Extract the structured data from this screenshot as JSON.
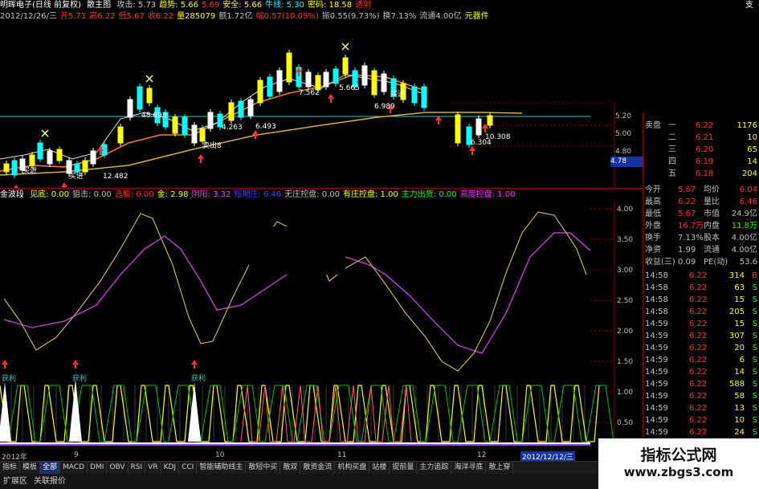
{
  "header": {
    "title": "明晖电子(日线 前复权)",
    "formula": "散主图",
    "items": [
      {
        "text": "攻击: 5.73",
        "color": "#d0d0d0"
      },
      {
        "text": "趋势: 5.66",
        "color": "#ffff00"
      },
      {
        "text": "5.69",
        "color": "#ff3030"
      },
      {
        "text": "安全: 5.66",
        "color": "#ffff00"
      },
      {
        "text": "牛线: 5.30",
        "color": "#00ffff"
      },
      {
        "text": "密码: 18.58",
        "color": "#ffff00"
      },
      {
        "text": "透射",
        "color": "#ff3030"
      }
    ],
    "right_char": "支"
  },
  "quote_line": {
    "items": [
      {
        "text": "2012/12/26/三",
        "color": "#c0c0c0"
      },
      {
        "text": "开5.71",
        "color": "#ff3030"
      },
      {
        "text": "高6.22",
        "color": "#ff3030"
      },
      {
        "text": "低5.67",
        "color": "#ff3030"
      },
      {
        "text": "收6.22",
        "color": "#ff3030"
      },
      {
        "text": "量285079",
        "color": "#ffff00"
      },
      {
        "text": "额1.72亿",
        "color": "#c0c0c0"
      },
      {
        "text": "幅0.57(10.09%)",
        "color": "#ff3030"
      },
      {
        "text": "振0.55(9.73%)",
        "color": "#c0c0c0"
      },
      {
        "text": "换7.13%",
        "color": "#c0c0c0"
      },
      {
        "text": "流通4.00亿",
        "color": "#c0c0c0"
      },
      {
        "text": "元器件",
        "color": "#ffff00"
      }
    ]
  },
  "main_chart": {
    "price_labels": [
      {
        "text": "48.693",
        "color": "#ffffff"
      },
      {
        "text": "4.263",
        "color": "#ffffff"
      },
      {
        "text": "6.493",
        "color": "#ffffff"
      },
      {
        "text": "7.562",
        "color": "#ffffff"
      },
      {
        "text": "5.665",
        "color": "#ffffff"
      },
      {
        "text": "6.989",
        "color": "#ffffff"
      },
      {
        "text": "12.482",
        "color": "#ffffff"
      },
      {
        "text": "10.308",
        "color": "#ffffff"
      },
      {
        "text": "6.304",
        "color": "#ffffff"
      }
    ],
    "signal_labels": [
      "买进",
      "卖出8",
      "买进",
      "买进"
    ],
    "axis_ticks": [
      "5.20",
      "5.00",
      "4.80"
    ],
    "price_box": "4.78"
  },
  "indicator": {
    "name": "金波段",
    "items": [
      {
        "text": "见底: 0.00",
        "color": "#ffff00"
      },
      {
        "text": "狙击: 0.00",
        "color": "#c0c0c0"
      },
      {
        "text": "选股: 0.00",
        "color": "#ff3030"
      },
      {
        "text": "金: 2.98",
        "color": "#ffff00"
      },
      {
        "text": "阴阳: 3.32",
        "color": "#ff30ff"
      },
      {
        "text": "短期庄: 6.46",
        "color": "#4040ff"
      },
      {
        "text": "无庄控盘: 0.00",
        "color": "#c0c0c0"
      },
      {
        "text": "有庄控盘: 1.00",
        "color": "#ffff00"
      },
      {
        "text": "主力出货: 0.00",
        "color": "#00ff00"
      },
      {
        "text": "高度控盘: 1.00",
        "color": "#ff30ff"
      }
    ],
    "axis_ticks": [
      "4.00",
      "3.50",
      "3.00",
      "2.50",
      "2.00",
      "1.50",
      "1.00",
      "0.50"
    ],
    "profit_labels": [
      "获利",
      "获利",
      "获利"
    ]
  },
  "date_axis": {
    "labels": [
      "2012年",
      "9",
      "10",
      "11",
      "12"
    ],
    "highlight": "2012/12/12/三"
  },
  "right_panel": {
    "ask_label": "卖盘",
    "ask_rows": [
      {
        "label": "一",
        "price": "6.22",
        "vol": "1176"
      },
      {
        "label": "二",
        "price": "6.21",
        "vol": "10"
      },
      {
        "label": "三",
        "price": "6.20",
        "vol": "65"
      },
      {
        "label": "四",
        "price": "6.19",
        "vol": "14"
      },
      {
        "label": "五",
        "price": "6.18",
        "vol": "204"
      }
    ],
    "stats": [
      {
        "l1": "今开",
        "v1": "5.67",
        "c1": "#ff3030",
        "l2": "均价",
        "v2": "6.04",
        "c2": "#ff3030"
      },
      {
        "l1": "最高",
        "v1": "6.22",
        "c1": "#ff3030",
        "l2": "量比",
        "v2": "6.46",
        "c2": "#ff3030"
      },
      {
        "l1": "最低",
        "v1": "5.67",
        "c1": "#ff3030",
        "l2": "市值",
        "v2": "24.9亿",
        "c2": "#c0c0c0"
      },
      {
        "l1": "外盘",
        "v1": "16.7万",
        "c1": "#ff3030",
        "l2": "内盘",
        "v2": "11.8万",
        "c2": "#00ff00"
      },
      {
        "l1": "换手",
        "v1": "7.13%",
        "c1": "#c0c0c0",
        "l2": "股本",
        "v2": "4.00亿",
        "c2": "#c0c0c0"
      },
      {
        "l1": "净资",
        "v1": "1.99",
        "c1": "#c0c0c0",
        "l2": "流通",
        "v2": "4.00亿",
        "c2": "#c0c0c0"
      },
      {
        "l1": "收益(三)",
        "v1": "0.09",
        "c1": "#c0c0c0",
        "l2": "PE(动)",
        "v2": "53.6",
        "c2": "#c0c0c0"
      }
    ],
    "ticks": [
      {
        "t": "14:58",
        "p": "6.22",
        "v": "314",
        "s": "B",
        "sc": "#ff3030"
      },
      {
        "t": "14:58",
        "p": "6.22",
        "v": "63",
        "s": "S",
        "sc": "#00ff00"
      },
      {
        "t": "14:58",
        "p": "6.22",
        "v": "15",
        "s": "S",
        "sc": "#00ff00"
      },
      {
        "t": "14:58",
        "p": "6.22",
        "v": "205",
        "s": "S",
        "sc": "#00ff00"
      },
      {
        "t": "14:59",
        "p": "6.22",
        "v": "15",
        "s": "S",
        "sc": "#00ff00"
      },
      {
        "t": "14:59",
        "p": "6.22",
        "v": "307",
        "s": "S",
        "sc": "#00ff00"
      },
      {
        "t": "14:59",
        "p": "6.22",
        "v": "20",
        "s": "S",
        "sc": "#00ff00"
      },
      {
        "t": "14:59",
        "p": "6.22",
        "v": "6",
        "s": "S",
        "sc": "#00ff00"
      },
      {
        "t": "14:59",
        "p": "6.22",
        "v": "14",
        "s": "S",
        "sc": "#00ff00"
      },
      {
        "t": "14:59",
        "p": "6.22",
        "v": "588",
        "s": "S",
        "sc": "#00ff00"
      },
      {
        "t": "14:59",
        "p": "6.22",
        "v": "58",
        "s": "S",
        "sc": "#00ff00"
      },
      {
        "t": "14:59",
        "p": "6.22",
        "v": "13",
        "s": "S",
        "sc": "#00ff00"
      },
      {
        "t": "14:59",
        "p": "6.22",
        "v": "10",
        "s": "S",
        "sc": "#00ff00"
      },
      {
        "t": "14:59",
        "p": "6.22",
        "v": "24",
        "s": "S",
        "sc": "#00ff00"
      }
    ]
  },
  "tabs": [
    "指标",
    "模板",
    "全部",
    "MACD",
    "DMI",
    "OBV",
    "RSI",
    "VR",
    "KDJ",
    "CCI",
    "智能辅助线主",
    "散短中买",
    "散双",
    "散资金流",
    "机构买盘",
    "站楼",
    "提前量",
    "主力追踪",
    "海洋寻底",
    "散上穿"
  ],
  "active_tab": "全部",
  "bottom_tabs": [
    "扩展区",
    "关联报价"
  ],
  "watermark": {
    "line1": "指标公式网",
    "line2": "www.zbgs3.com"
  }
}
